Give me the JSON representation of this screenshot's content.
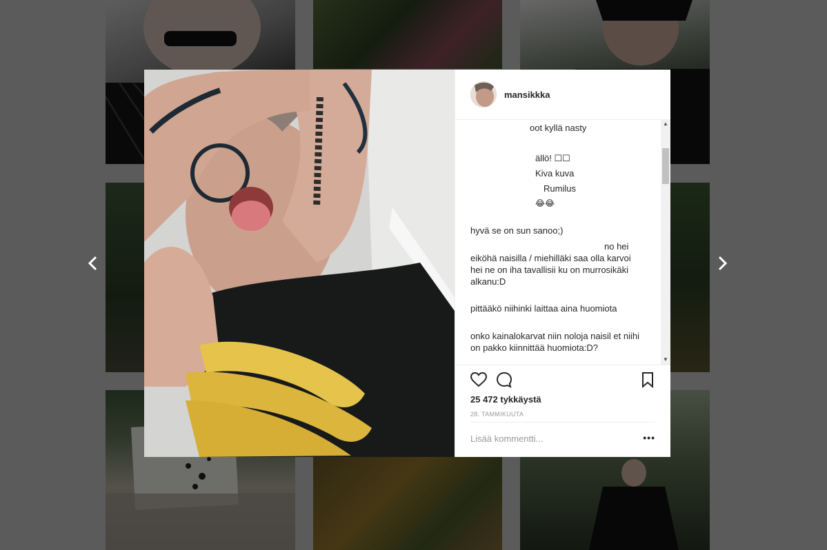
{
  "post": {
    "username": "mansikkka",
    "likes_text": "25 472 tykkäystä",
    "date_text": "28. TAMMIKUUTA"
  },
  "comments": [
    "oot kyllä nasty",
    "ällö! ☐☐",
    "Kiva kuva",
    "Rumilus",
    "😂😂",
    "hyvä se on sun sanoo;)",
    "no hei",
    "eiköhä naisilla / miehilläki saa olla karvoi",
    "hei ne on iha tavallisii ku on murrosikäki",
    "alkanu:D",
    "pittääkö niihinki laittaa aina huomiota",
    "onko kainalokarvat niin noloja naisil et niihi",
    "on pakko kiinnittää huomiota:D?"
  ],
  "add_comment": {
    "placeholder": "Lisää kommentti..."
  },
  "icons": {
    "prev": "chevron-left-icon",
    "next": "chevron-right-icon",
    "like": "heart-icon",
    "comment": "comment-icon",
    "save": "bookmark-icon",
    "more": "more-options-icon"
  },
  "colors": {
    "overlay": "#5b5b5b",
    "text": "#262626",
    "muted": "#999999"
  }
}
